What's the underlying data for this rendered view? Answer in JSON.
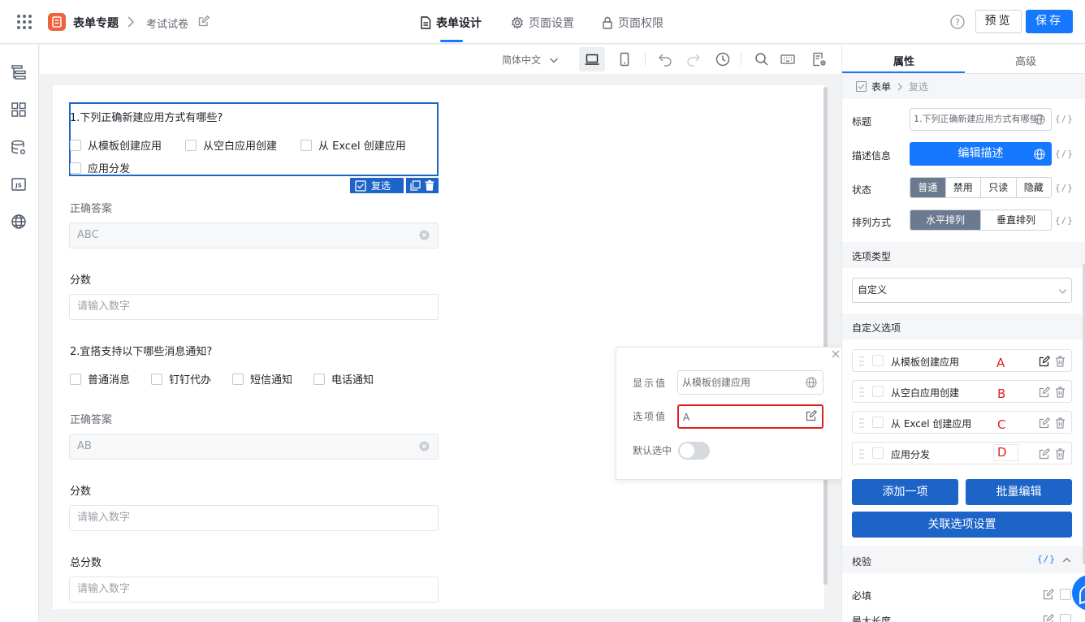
{
  "header": {
    "app_name": "表单专题",
    "page_name": "考试试卷",
    "tabs": [
      {
        "label": "表单设计",
        "active": true
      },
      {
        "label": "页面设置",
        "active": false
      },
      {
        "label": "页面权限",
        "active": false
      }
    ],
    "preview_label": "预览",
    "save_label": "保存"
  },
  "toolbar": {
    "language": "简体中文"
  },
  "form": {
    "q1": {
      "title": "1.下列正确新建应用方式有哪些?",
      "options": [
        "从模板创建应用",
        "从空白应用创建",
        "从 Excel 创建应用",
        "应用分发"
      ],
      "selected_tag": "复选"
    },
    "q1_answer": {
      "label": "正确答案",
      "value": "ABC"
    },
    "q1_score": {
      "label": "分数",
      "placeholder": "请输入数字"
    },
    "q2": {
      "title": "2.宜搭支持以下哪些消息通知?",
      "options": [
        "普通消息",
        "钉钉代办",
        "短信通知",
        "电话通知"
      ]
    },
    "q2_answer": {
      "label": "正确答案",
      "value": "AB"
    },
    "q2_score": {
      "label": "分数",
      "placeholder": "请输入数字"
    },
    "total": {
      "label": "总分数",
      "placeholder": "请输入数字"
    }
  },
  "popover": {
    "display_label": "显示值",
    "display_value": "从模板创建应用",
    "option_label": "选项值",
    "option_value": "A",
    "default_label": "默认选中"
  },
  "panel": {
    "tabs": [
      "属性",
      "高级"
    ],
    "breadcrumb": {
      "root": "表单",
      "current": "复选"
    },
    "expr_label": "{/}",
    "title_label": "标题",
    "title_value": "1.下列正确新建应用方式有哪些?",
    "desc_label": "描述信息",
    "desc_button": "编辑描述",
    "status_label": "状态",
    "status_options": [
      "普通",
      "禁用",
      "只读",
      "隐藏"
    ],
    "layout_label": "排列方式",
    "layout_options": [
      "水平排列",
      "垂直排列"
    ],
    "option_type_heading": "选项类型",
    "option_type_value": "自定义",
    "custom_options_heading": "自定义选项",
    "custom_options": [
      {
        "label": "从模板创建应用",
        "mark": "A"
      },
      {
        "label": "从空白应用创建",
        "mark": "B"
      },
      {
        "label": "从 Excel 创建应用",
        "mark": "C"
      },
      {
        "label": "应用分发",
        "mark": "D"
      }
    ],
    "add_item": "添加一项",
    "batch_edit": "批量编辑",
    "linkage": "关联选项设置",
    "validation_heading": "校验",
    "required_label": "必填",
    "maxlen_label": "最大长度"
  },
  "colors": {
    "primary": "#1677ff",
    "selection": "#1d64c9",
    "highlight": "#e02020",
    "brand": "#f0613d"
  }
}
